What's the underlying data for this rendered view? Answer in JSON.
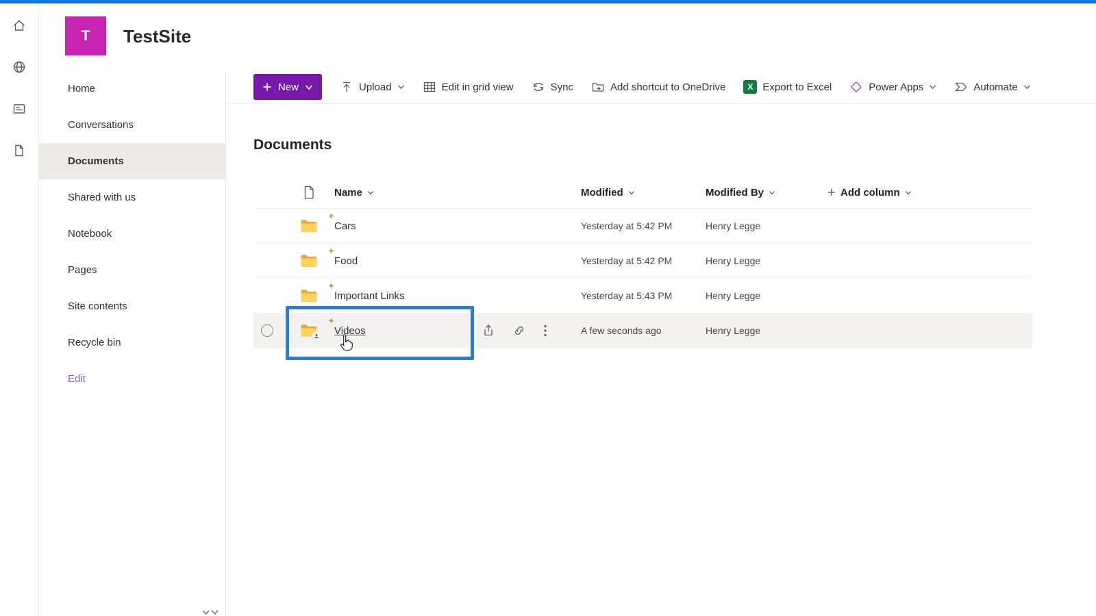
{
  "site_header": {
    "logo_letter": "T",
    "title": "TestSite"
  },
  "app_rail": {
    "icons": [
      "home-icon",
      "globe-icon",
      "news-icon",
      "pages-icon"
    ]
  },
  "sidebar": {
    "items": [
      {
        "label": "Home"
      },
      {
        "label": "Conversations"
      },
      {
        "label": "Documents",
        "selected": true
      },
      {
        "label": "Shared with us"
      },
      {
        "label": "Notebook"
      },
      {
        "label": "Pages"
      },
      {
        "label": "Site contents"
      },
      {
        "label": "Recycle bin"
      },
      {
        "label": "Edit",
        "accent": true
      }
    ]
  },
  "command_bar": {
    "new_button": {
      "label": "New"
    },
    "items": [
      {
        "label": "Upload",
        "chevron": true
      },
      {
        "label": "Edit in grid view"
      },
      {
        "label": "Sync"
      },
      {
        "label": "Add shortcut to OneDrive"
      },
      {
        "label": "Export to Excel"
      },
      {
        "label": "Power Apps",
        "chevron": true
      },
      {
        "label": "Automate",
        "chevron": true
      }
    ]
  },
  "page": {
    "title": "Documents"
  },
  "table": {
    "columns": {
      "name": "Name",
      "modified": "Modified",
      "modified_by": "Modified By",
      "add_column": "Add column"
    },
    "rows": [
      {
        "name": "Cars",
        "modified": "Yesterday at 5:42 PM",
        "modified_by": "Henry Legge"
      },
      {
        "name": "Food",
        "modified": "Yesterday at 5:42 PM",
        "modified_by": "Henry Legge"
      },
      {
        "name": "Important Links",
        "modified": "Yesterday at 5:43 PM",
        "modified_by": "Henry Legge"
      },
      {
        "name": "Videos",
        "modified": "A few seconds ago",
        "modified_by": "Henry Legge",
        "hovered": true
      }
    ]
  },
  "colors": {
    "accent_purple": "#7719aa",
    "logo_magenta": "#c724b1",
    "annotation_blue": "#2b7cd3",
    "excel_green": "#107c41",
    "top_strip_blue": "#1673e6",
    "folder_gold": "#ffd05c"
  }
}
